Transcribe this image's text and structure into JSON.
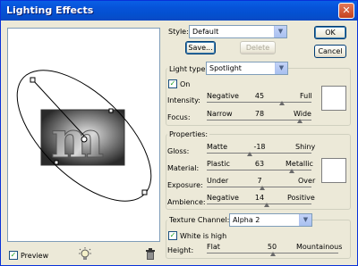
{
  "window": {
    "title": "Lighting Effects"
  },
  "preview": {
    "checkbox_label": "Preview",
    "checked": true
  },
  "style": {
    "label": "Style:",
    "value": "Default",
    "save_label": "Save...",
    "delete_label": "Delete"
  },
  "buttons": {
    "ok": "OK",
    "cancel": "Cancel"
  },
  "light": {
    "type_label": "Light type:",
    "type_value": "Spotlight",
    "on_label": "On",
    "on_checked": true,
    "intensity": {
      "label": "Intensity:",
      "min": "Negative",
      "value": "45",
      "max": "Full",
      "level": 0.72
    },
    "focus": {
      "label": "Focus:",
      "min": "Narrow",
      "value": "78",
      "max": "Wide",
      "level": 0.89
    }
  },
  "properties": {
    "title": "Properties:",
    "gloss": {
      "label": "Gloss:",
      "min": "Matte",
      "value": "-18",
      "max": "Shiny",
      "level": 0.41
    },
    "material": {
      "label": "Material:",
      "min": "Plastic",
      "value": "63",
      "max": "Metallic",
      "level": 0.81
    },
    "exposure": {
      "label": "Exposure:",
      "min": "Under",
      "value": "7",
      "max": "Over",
      "level": 0.53
    },
    "ambience": {
      "label": "Ambience:",
      "min": "Negative",
      "value": "14",
      "max": "Positive",
      "level": 0.57
    }
  },
  "texture": {
    "channel_label": "Texture Channel:",
    "channel_value": "Alpha 2",
    "white_high_label": "White is high",
    "white_high_checked": true,
    "height": {
      "label": "Height:",
      "min": "Flat",
      "value": "50",
      "max": "Mountainous",
      "level": 0.5
    }
  },
  "colors": {
    "title_bar": "#0653d9",
    "close": "#c4421e",
    "dialog_bg": "#ece9d8",
    "swatch": "#ffffff"
  }
}
